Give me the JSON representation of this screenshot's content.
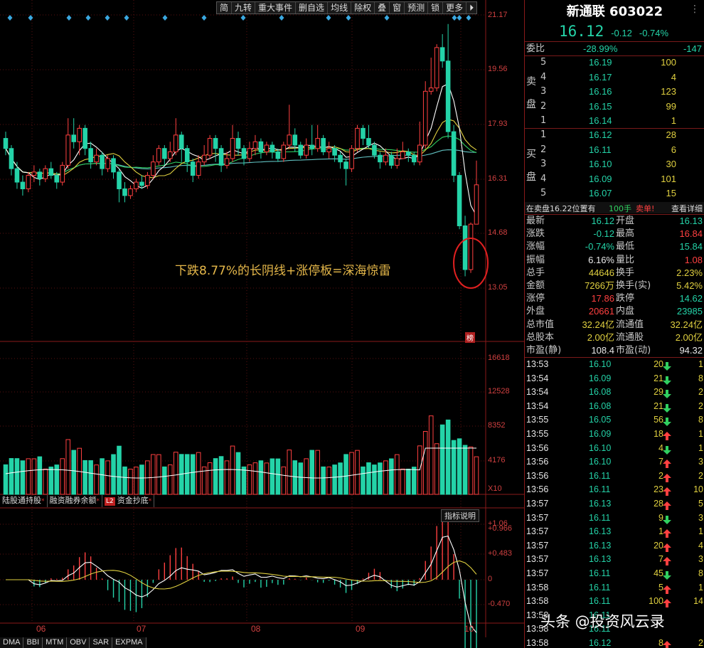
{
  "toolbar": [
    "简",
    "九转",
    "重大事件",
    "删自选",
    "均线",
    "除权",
    "叠",
    "窗",
    "预测",
    "锁",
    "更多",
    "⏵"
  ],
  "price_axis": [
    "21.17",
    "19.56",
    "17.93",
    "16.31",
    "14.68",
    "13.05"
  ],
  "volume_axis": [
    "16618",
    "12528",
    "8352",
    "4176"
  ],
  "volume_unit": "X10",
  "macd_axis": [
    "+1.06",
    "+0.966",
    "+0.483",
    "0",
    "-0.470"
  ],
  "x_axis_labels": [
    "06",
    "07",
    "08",
    "09",
    "10"
  ],
  "annotation": "下跌8.77%的长阴线+涨停板=深海惊雷",
  "bang_badge": "榜",
  "sub_tabs": [
    "陆股通持股",
    "融资融券余额",
    "资金抄底"
  ],
  "l2_badge": "L2",
  "indicator_help": "指标说明",
  "bottom_tabs": [
    "DMA",
    "BBI",
    "MTM",
    "OBV",
    "SAR",
    "EXPMA"
  ],
  "colors": {
    "up": "#ff4040",
    "down": "#24d3a8",
    "ma_white": "#ffffff",
    "ma_yellow": "#e0d040",
    "ma_green": "#30d060",
    "ma_cyan": "#60c0c0"
  },
  "chart_data": {
    "type": "candlestick",
    "ylim": [
      13.05,
      21.17
    ],
    "candles": [
      [
        17.5,
        17.2,
        17.7,
        17.0
      ],
      [
        17.2,
        16.6,
        17.3,
        16.4
      ],
      [
        16.6,
        16.2,
        16.8,
        16.0
      ],
      [
        16.2,
        16.0,
        16.4,
        15.8
      ],
      [
        16.0,
        16.4,
        16.5,
        15.9
      ],
      [
        16.4,
        16.5,
        16.7,
        16.2
      ],
      [
        16.5,
        16.3,
        16.6,
        16.1
      ],
      [
        16.3,
        16.6,
        16.7,
        16.2
      ],
      [
        16.6,
        16.4,
        16.8,
        16.3
      ],
      [
        16.4,
        16.2,
        16.5,
        16.0
      ],
      [
        16.2,
        16.7,
        16.8,
        16.1
      ],
      [
        16.7,
        17.6,
        18.1,
        16.6
      ],
      [
        17.6,
        17.4,
        18.1,
        17.2
      ],
      [
        17.4,
        17.8,
        17.9,
        17.0
      ],
      [
        17.8,
        17.2,
        17.9,
        17.0
      ],
      [
        17.2,
        16.8,
        17.4,
        16.6
      ],
      [
        16.8,
        17.0,
        17.2,
        16.7
      ],
      [
        17.0,
        16.6,
        17.1,
        16.4
      ],
      [
        16.6,
        16.9,
        17.0,
        16.5
      ],
      [
        16.9,
        16.5,
        17.0,
        16.3
      ],
      [
        16.5,
        16.0,
        16.6,
        15.6
      ],
      [
        16.0,
        15.8,
        16.2,
        15.6
      ],
      [
        15.8,
        16.0,
        16.1,
        15.7
      ],
      [
        16.0,
        16.2,
        16.3,
        15.9
      ],
      [
        16.2,
        16.1,
        16.4,
        16.0
      ],
      [
        16.1,
        16.4,
        16.5,
        16.0
      ],
      [
        16.4,
        16.8,
        17.0,
        16.3
      ],
      [
        16.8,
        17.2,
        17.3,
        16.7
      ],
      [
        17.2,
        16.9,
        17.3,
        16.7
      ],
      [
        16.9,
        17.1,
        17.4,
        16.8
      ],
      [
        17.1,
        17.6,
        18.1,
        17.0
      ],
      [
        17.6,
        17.2,
        17.7,
        16.8
      ],
      [
        17.2,
        16.8,
        17.3,
        16.5
      ],
      [
        16.8,
        16.4,
        16.9,
        16.2
      ],
      [
        16.4,
        16.8,
        17.0,
        16.3
      ],
      [
        16.8,
        17.0,
        17.3,
        16.7
      ],
      [
        17.0,
        17.5,
        17.6,
        16.9
      ],
      [
        17.5,
        17.2,
        17.6,
        16.8
      ],
      [
        17.2,
        16.7,
        17.3,
        16.5
      ],
      [
        16.7,
        16.9,
        17.1,
        16.6
      ],
      [
        16.9,
        17.5,
        17.9,
        16.8
      ],
      [
        17.5,
        17.2,
        17.7,
        17.0
      ],
      [
        17.2,
        16.9,
        17.3,
        16.7
      ],
      [
        16.9,
        17.2,
        17.4,
        16.8
      ],
      [
        17.2,
        17.4,
        17.6,
        17.0
      ],
      [
        17.4,
        17.1,
        17.5,
        16.9
      ],
      [
        17.1,
        17.3,
        17.4,
        17.0
      ],
      [
        17.3,
        17.1,
        17.4,
        16.9
      ],
      [
        17.1,
        16.9,
        17.2,
        16.8
      ],
      [
        16.9,
        17.3,
        17.4,
        16.8
      ],
      [
        17.3,
        17.6,
        18.5,
        17.2
      ],
      [
        17.6,
        17.3,
        17.8,
        17.1
      ],
      [
        17.3,
        17.0,
        17.4,
        16.9
      ],
      [
        17.0,
        17.3,
        17.5,
        16.9
      ],
      [
        17.3,
        17.2,
        17.9,
        17.0
      ],
      [
        17.2,
        17.5,
        17.9,
        17.1
      ],
      [
        17.5,
        17.1,
        17.6,
        17.0
      ],
      [
        17.1,
        17.2,
        17.4,
        16.9
      ],
      [
        17.2,
        17.0,
        17.3,
        16.8
      ],
      [
        17.0,
        16.8,
        17.1,
        16.6
      ],
      [
        16.8,
        16.6,
        16.9,
        16.1
      ],
      [
        16.6,
        17.2,
        17.3,
        16.5
      ],
      [
        17.2,
        17.8,
        17.9,
        17.1
      ],
      [
        17.8,
        17.5,
        17.9,
        17.3
      ],
      [
        17.5,
        17.3,
        17.9,
        17.2
      ],
      [
        17.3,
        17.0,
        17.4,
        16.9
      ],
      [
        17.0,
        16.8,
        17.1,
        16.6
      ],
      [
        16.8,
        17.0,
        17.2,
        16.7
      ],
      [
        17.0,
        16.7,
        17.1,
        16.6
      ],
      [
        16.7,
        16.9,
        17.2,
        16.6
      ],
      [
        16.9,
        17.1,
        17.4,
        16.9
      ],
      [
        17.1,
        17.0,
        17.2,
        16.8
      ],
      [
        17.0,
        16.8,
        17.1,
        16.7
      ],
      [
        16.8,
        17.3,
        18.0,
        16.7
      ],
      [
        17.3,
        18.9,
        19.2,
        17.2
      ],
      [
        18.9,
        19.0,
        19.9,
        18.8
      ],
      [
        19.0,
        20.2,
        20.3,
        18.9
      ],
      [
        20.2,
        19.8,
        20.6,
        19.6
      ],
      [
        19.8,
        17.7,
        20.9,
        17.5
      ],
      [
        17.7,
        16.4,
        17.9,
        16.2
      ],
      [
        16.4,
        14.9,
        16.5,
        14.8
      ],
      [
        14.9,
        13.6,
        15.2,
        13.4
      ],
      [
        13.6,
        14.95,
        15.0,
        13.5
      ],
      [
        14.95,
        16.12,
        16.84,
        15.84
      ]
    ],
    "volume_ylim": [
      0,
      16618
    ]
  },
  "quote": {
    "title": "新通联 603022",
    "price": "16.12",
    "change": "-0.12",
    "change_pct": "-0.74%",
    "webi_label": "委比",
    "webi_pct": "-28.99%",
    "webi_diff": "-147",
    "sell_label": [
      "卖",
      "盘"
    ],
    "buy_label": [
      "买",
      "盘"
    ],
    "asks": [
      {
        "lvl": "5",
        "price": "16.19",
        "vol": "100"
      },
      {
        "lvl": "4",
        "price": "16.17",
        "vol": "4"
      },
      {
        "lvl": "3",
        "price": "16.16",
        "vol": "123"
      },
      {
        "lvl": "2",
        "price": "16.15",
        "vol": "99"
      },
      {
        "lvl": "1",
        "price": "16.14",
        "vol": "1"
      }
    ],
    "bids": [
      {
        "lvl": "1",
        "price": "16.12",
        "vol": "28"
      },
      {
        "lvl": "2",
        "price": "16.11",
        "vol": "6"
      },
      {
        "lvl": "3",
        "price": "16.10",
        "vol": "30"
      },
      {
        "lvl": "4",
        "price": "16.09",
        "vol": "101"
      },
      {
        "lvl": "5",
        "price": "16.07",
        "vol": "15"
      }
    ],
    "status": {
      "text": "在卖盘16.22位置有",
      "qty": "100手",
      "action": "卖单!",
      "detail": "查看详细"
    },
    "stats": [
      {
        "l1": "最新",
        "v1": "16.12",
        "c1": "green",
        "l2": "开盘",
        "v2": "16.13",
        "c2": "green"
      },
      {
        "l1": "涨跌",
        "v1": "-0.12",
        "c1": "green",
        "l2": "最高",
        "v2": "16.84",
        "c2": "red"
      },
      {
        "l1": "涨幅",
        "v1": "-0.74%",
        "c1": "green",
        "l2": "最低",
        "v2": "15.84",
        "c2": "green"
      },
      {
        "l1": "振幅",
        "v1": "6.16%",
        "c1": "white",
        "l2": "量比",
        "v2": "1.08",
        "c2": "red"
      },
      {
        "l1": "总手",
        "v1": "44646",
        "c1": "yellow",
        "l2": "换手",
        "v2": "2.23%",
        "c2": "yellow"
      },
      {
        "l1": "金额",
        "v1": "7266万",
        "c1": "yellow",
        "l2": "换手(实)",
        "v2": "5.42%",
        "c2": "yellow"
      },
      {
        "l1": "涨停",
        "v1": "17.86",
        "c1": "red",
        "l2": "跌停",
        "v2": "14.62",
        "c2": "green"
      },
      {
        "l1": "外盘",
        "v1": "20661",
        "c1": "red",
        "l2": "内盘",
        "v2": "23985",
        "c2": "green"
      },
      {
        "l1": "总市值",
        "v1": "32.24亿",
        "c1": "yellow",
        "l2": "流通值",
        "v2": "32.24亿",
        "c2": "yellow"
      },
      {
        "l1": "总股本",
        "v1": "2.00亿",
        "c1": "yellow",
        "l2": "流通股",
        "v2": "2.00亿",
        "c2": "yellow"
      },
      {
        "l1": "市盈(静)",
        "v1": "108.4",
        "c1": "white",
        "l2": "市盈(动)",
        "v2": "94.32",
        "c2": "white"
      }
    ],
    "ticks": [
      {
        "t": "13:53",
        "p": "16.10",
        "v": "20",
        "d": "down",
        "n": "1"
      },
      {
        "t": "13:54",
        "p": "16.09",
        "v": "21",
        "d": "down",
        "n": "8"
      },
      {
        "t": "13:54",
        "p": "16.08",
        "v": "29",
        "d": "down",
        "n": "2"
      },
      {
        "t": "13:54",
        "p": "16.08",
        "v": "21",
        "d": "down",
        "n": "2"
      },
      {
        "t": "13:55",
        "p": "16.05",
        "v": "56",
        "d": "down",
        "n": "8"
      },
      {
        "t": "13:55",
        "p": "16.09",
        "v": "18",
        "d": "up",
        "n": "1"
      },
      {
        "t": "13:56",
        "p": "16.10",
        "v": "4",
        "d": "down",
        "n": "1"
      },
      {
        "t": "13:56",
        "p": "16.10",
        "v": "7",
        "d": "up",
        "n": "3"
      },
      {
        "t": "13:56",
        "p": "16.11",
        "v": "2",
        "d": "up",
        "n": "2"
      },
      {
        "t": "13:56",
        "p": "16.11",
        "v": "23",
        "d": "up",
        "n": "10"
      },
      {
        "t": "13:57",
        "p": "16.13",
        "v": "28",
        "d": "up",
        "n": "5"
      },
      {
        "t": "13:57",
        "p": "16.11",
        "v": "9",
        "d": "down",
        "n": "3"
      },
      {
        "t": "13:57",
        "p": "16.13",
        "v": "1",
        "d": "up",
        "n": "1"
      },
      {
        "t": "13:57",
        "p": "16.13",
        "v": "20",
        "d": "up",
        "n": "4"
      },
      {
        "t": "13:57",
        "p": "16.13",
        "v": "7",
        "d": "up",
        "n": "3"
      },
      {
        "t": "13:57",
        "p": "16.11",
        "v": "45",
        "d": "down",
        "n": "8"
      },
      {
        "t": "13:58",
        "p": "16.11",
        "v": "5",
        "d": "up",
        "n": "1"
      },
      {
        "t": "13:58",
        "p": "16.11",
        "v": "100",
        "d": "up",
        "n": "14"
      },
      {
        "t": "13:58",
        "p": "16.11",
        "v": "",
        "d": "",
        "n": ""
      },
      {
        "t": "13:58",
        "p": "16.11",
        "v": "",
        "d": "",
        "n": ""
      },
      {
        "t": "13:58",
        "p": "16.12",
        "v": "8",
        "d": "up",
        "n": "2"
      }
    ]
  },
  "watermark": "头条 @投资风云录"
}
